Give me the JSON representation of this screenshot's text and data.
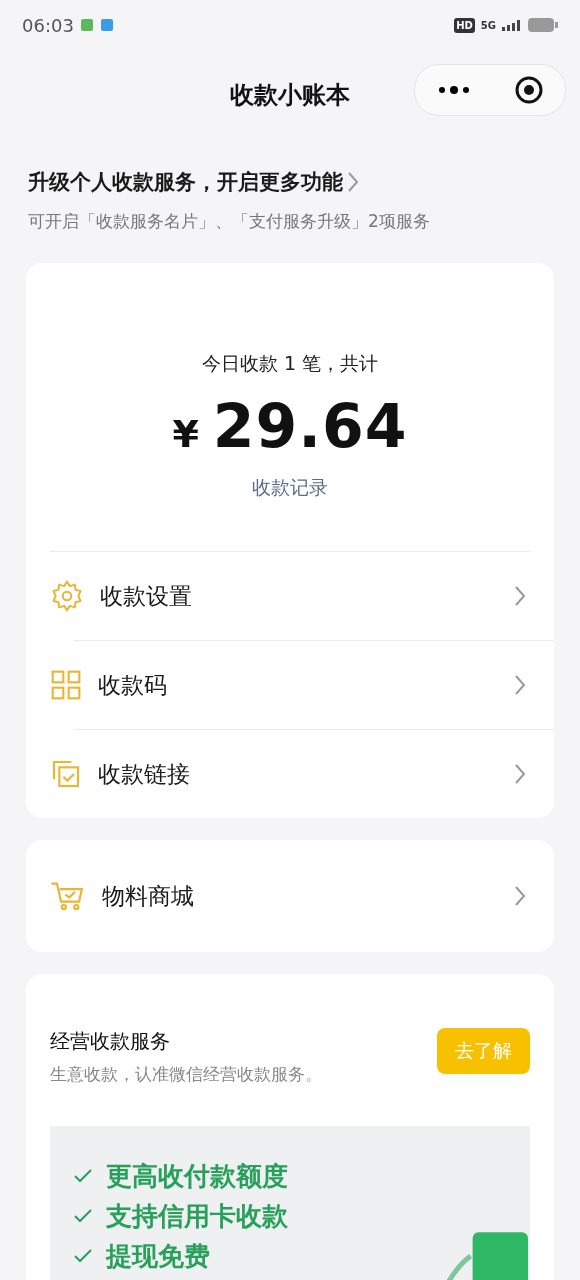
{
  "status_bar": {
    "time": "06:03",
    "hd_badge": "HD",
    "network": "5G"
  },
  "header": {
    "title": "收款小账本"
  },
  "upgrade": {
    "title": "升级个人收款服务，开启更多功能",
    "subtitle": "可开启「收款服务名片」、「支付服务升级」2项服务"
  },
  "summary": {
    "caption": "今日收款 1 笔，共计",
    "currency": "¥",
    "amount": "29.64",
    "link": "收款记录"
  },
  "menu": [
    {
      "kind": "gear",
      "label": "收款设置"
    },
    {
      "kind": "qr",
      "label": "收款码"
    },
    {
      "kind": "link",
      "label": "收款链接"
    }
  ],
  "shop": [
    {
      "kind": "cart",
      "label": "物料商城"
    }
  ],
  "service": {
    "title": "经营收款服务",
    "subtitle": "生意收款，认准微信经营收款服务。",
    "button": "去了解",
    "features": [
      "更高收付款额度",
      "支持信用卡收款",
      "提现免费"
    ]
  }
}
